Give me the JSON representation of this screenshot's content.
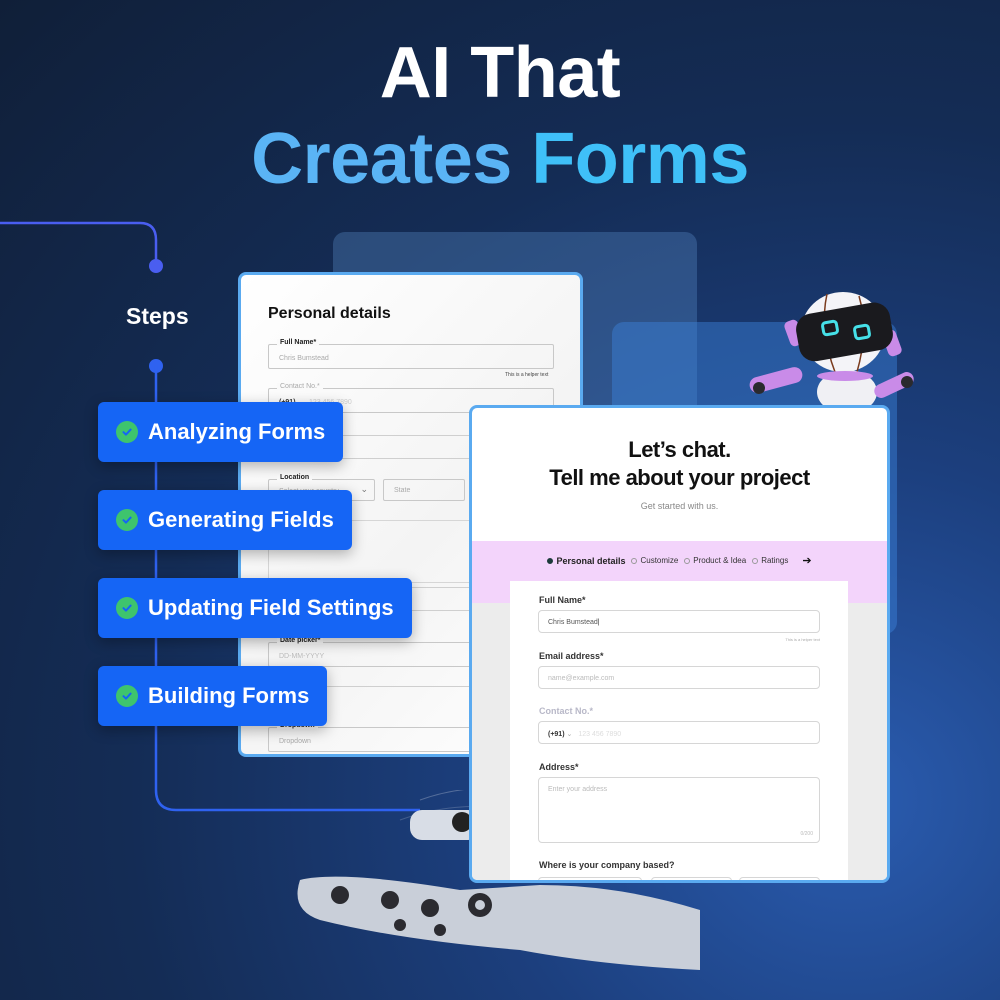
{
  "headline": {
    "line1": "AI That",
    "line2_part1": "Creates ",
    "line2_part2": "Forms"
  },
  "colors": {
    "accent_blue": "#1565f5",
    "headline_light_blue": "#5ab4f5",
    "check_green": "#3ec46d",
    "card_border": "#5aaaf0",
    "stepper_pink": "#f3d4fb"
  },
  "steps": {
    "label": "Steps",
    "items": [
      {
        "label": "Analyzing Forms",
        "icon": "check-circle-icon"
      },
      {
        "label": "Generating Fields",
        "icon": "check-circle-icon"
      },
      {
        "label": "Updating Field Settings",
        "icon": "check-circle-icon"
      },
      {
        "label": "Building Forms",
        "icon": "check-circle-icon"
      }
    ]
  },
  "left_form": {
    "title": "Personal details",
    "full_name_label": "Full Name*",
    "full_name_value": "Chris Bumstead",
    "helper_text": "This is a helper text",
    "contact_label": "Contact No.*",
    "contact_code": "(+91)",
    "contact_placeholder": "123 456 7890",
    "location_label": "Location",
    "country_placeholder": "Select your country",
    "state_placeholder": "State",
    "date_label": "Date picker*",
    "date_placeholder": "DD-MM-YYYY",
    "dropdown_label": "Dropdown",
    "dropdown_placeholder": "Dropdown"
  },
  "right_form": {
    "title_line1": "Let’s chat.",
    "title_line2": "Tell me about your project",
    "subtitle": "Get started with us.",
    "stepper": [
      {
        "label": "Personal details",
        "active": true
      },
      {
        "label": "Customize",
        "active": false
      },
      {
        "label": "Product & Idea",
        "active": false
      },
      {
        "label": "Ratings",
        "active": false
      }
    ],
    "stepper_next_icon": "arrow-right-icon",
    "full_name_label": "Full Name*",
    "full_name_value": "Chris Bumstead",
    "helper_text": "This is a helper text",
    "email_label": "Email address*",
    "email_placeholder": "name@example.com",
    "contact_label": "Contact No.*",
    "contact_code": "(+91)",
    "contact_placeholder": "123 456 7890",
    "address_label": "Address*",
    "address_placeholder": "Enter your address",
    "address_counter": "0/200",
    "company_label": "Where is your company based?"
  }
}
